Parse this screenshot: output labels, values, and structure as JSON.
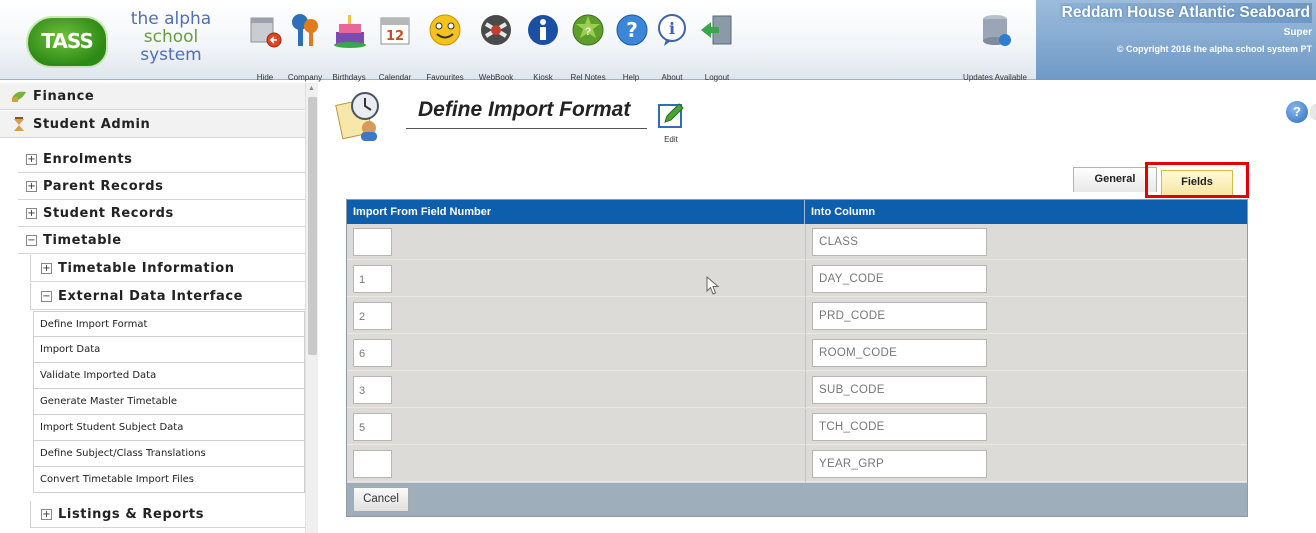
{
  "logo": {
    "badge": "TASS",
    "line1": "the alpha",
    "line2": "school",
    "line3": "system"
  },
  "toolbar": [
    {
      "label": "Hide",
      "icon": "hide-icon"
    },
    {
      "label": "Company",
      "icon": "keys-icon"
    },
    {
      "label": "Birthdays",
      "icon": "cake-icon"
    },
    {
      "label": "Calendar",
      "icon": "calendar-icon"
    },
    {
      "label": "Favourites",
      "icon": "smiley-icon"
    },
    {
      "label": "WebBook",
      "icon": "webbook-icon"
    },
    {
      "label": "Kiosk",
      "icon": "info-icon"
    },
    {
      "label": "Rel Notes",
      "icon": "release-notes-icon"
    },
    {
      "label": "Help",
      "icon": "help-icon"
    },
    {
      "label": "About",
      "icon": "about-icon"
    },
    {
      "label": "Logout",
      "icon": "logout-icon"
    },
    {
      "label": "Updates Available",
      "icon": "updates-icon"
    }
  ],
  "calendar_number": "12",
  "header": {
    "school_name": "Reddam House Atlantic Seaboard",
    "user_role": "Super",
    "copyright": "© Copyright 2016 the alpha school system PT"
  },
  "sidebar": {
    "sections": [
      {
        "label": "Finance",
        "icon": "finance-icon"
      },
      {
        "label": "Student Admin",
        "icon": "student-admin-icon"
      }
    ],
    "groups": [
      {
        "label": "Enrolments",
        "expander": "+"
      },
      {
        "label": "Parent Records",
        "expander": "+"
      },
      {
        "label": "Student Records",
        "expander": "+"
      },
      {
        "label": "Timetable",
        "expander": "−"
      }
    ],
    "subgroups": [
      {
        "label": "Timetable Information",
        "expander": "+"
      },
      {
        "label": "External Data Interface",
        "expander": "−"
      }
    ],
    "items": [
      "Define Import Format",
      "Import Data",
      "Validate Imported Data",
      "Generate Master Timetable",
      "Import Student Subject Data",
      "Define Subject/Class Translations",
      "Convert Timetable Import Files"
    ],
    "after": {
      "label": "Listings & Reports",
      "expander": "+"
    }
  },
  "page": {
    "title": "Define Import Format",
    "edit_label": "Edit",
    "help_glyph": "?"
  },
  "tabs": {
    "general": "General",
    "fields": "Fields"
  },
  "table": {
    "headers": [
      "Import From Field Number",
      "Into Column"
    ],
    "rows": [
      {
        "field_number": "",
        "column": "CLASS"
      },
      {
        "field_number": "1",
        "column": "DAY_CODE"
      },
      {
        "field_number": "2",
        "column": "PRD_CODE"
      },
      {
        "field_number": "6",
        "column": "ROOM_CODE"
      },
      {
        "field_number": "3",
        "column": "SUB_CODE"
      },
      {
        "field_number": "5",
        "column": "TCH_CODE"
      },
      {
        "field_number": "",
        "column": "YEAR_GRP"
      }
    ]
  },
  "cancel_label": "Cancel",
  "colors": {
    "header_blue": "#0d5fad",
    "panel_bg": "#dddbd7",
    "footer_bg": "#9eaebb",
    "highlight": "#e60000"
  }
}
